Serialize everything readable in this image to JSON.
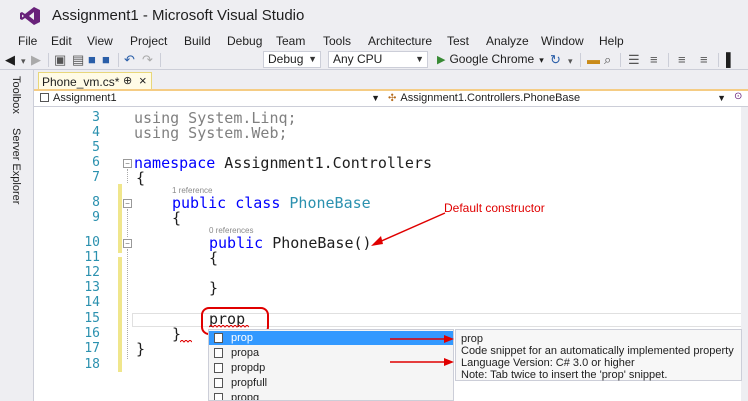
{
  "window": {
    "title": "Assignment1 - Microsoft Visual Studio"
  },
  "menu": [
    "File",
    "Edit",
    "View",
    "Project",
    "Build",
    "Debug",
    "Team",
    "Tools",
    "Architecture",
    "Test",
    "Analyze",
    "Window",
    "Help"
  ],
  "toolbar": {
    "configuration": "Debug",
    "platform": "Any CPU",
    "run_target": "Google Chrome"
  },
  "side_tabs": [
    "Toolbox",
    "Server Explorer"
  ],
  "document_tab": {
    "label": "Phone_vm.cs*",
    "pin": "⊕",
    "close": "×"
  },
  "navigation": {
    "project": "Assignment1",
    "type": "Assignment1.Controllers.PhoneBase"
  },
  "line_numbers": [
    "3",
    "4",
    "5",
    "6",
    "7",
    "8",
    "9",
    "10",
    "11",
    "12",
    "13",
    "14",
    "15",
    "16",
    "17",
    "18"
  ],
  "code": {
    "l3_kw": "using",
    "l3_rest": " System.Linq;",
    "l4_kw": "using",
    "l4_rest": " System.Web;",
    "l6_kw": "namespace",
    "l6_rest": " Assignment1.Controllers",
    "l7": "{",
    "ref1": "1 reference",
    "l8_kw": "public class",
    "l8_cls": "PhoneBase",
    "l9": "{",
    "ref0": "0 references",
    "l10_kw": "public",
    "l10_rest": " PhoneBase()",
    "l11": "{",
    "l13": "}",
    "l15": "prop",
    "l16": "}",
    "l17": "}"
  },
  "annotation": {
    "text": "Default constructor",
    "color": "#e00000"
  },
  "completion": {
    "items": [
      "prop",
      "propa",
      "propdp",
      "propfull",
      "propg"
    ],
    "selected": "prop"
  },
  "tooltip": {
    "lines": [
      "prop",
      "Code snippet for an automatically implemented property",
      "Language Version: C# 3.0 or higher",
      "Note: Tab twice to insert the 'prop' snippet."
    ]
  },
  "colors": {
    "keyword": "#0000ff",
    "type": "#2b91af",
    "selection": "#3399ff",
    "annotation": "#e00000"
  }
}
